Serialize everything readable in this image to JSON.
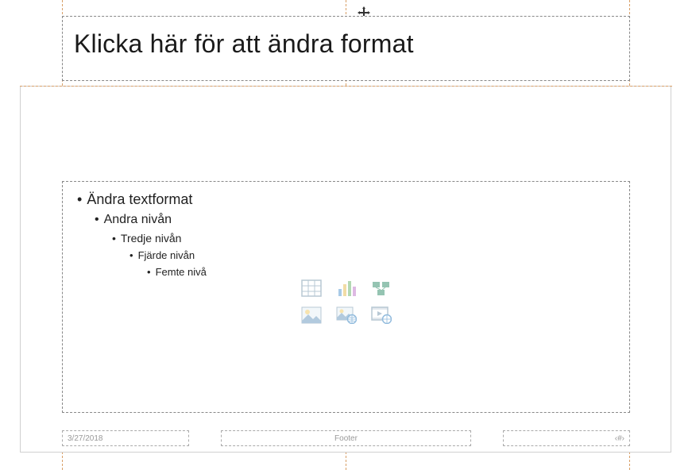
{
  "title": {
    "text": "Klicka här för att ändra format"
  },
  "content": {
    "levels": {
      "l1": "Ändra textformat",
      "l2": "Andra nivån",
      "l3": "Tredje nivån",
      "l4": "Fjärde nivån",
      "l5": "Femte nivå"
    },
    "icons": {
      "table": "insert-table-icon",
      "chart": "insert-chart-icon",
      "smartart": "insert-smartart-icon",
      "picture": "insert-picture-icon",
      "onlinepic": "insert-online-picture-icon",
      "video": "insert-video-icon"
    }
  },
  "footer": {
    "date": "3/27/2018",
    "text": "Footer",
    "slide_number": "‹#›"
  }
}
